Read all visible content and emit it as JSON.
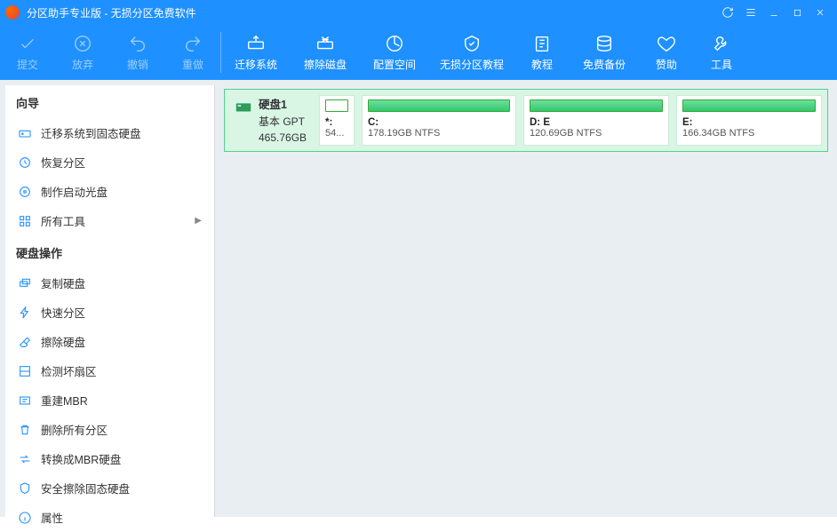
{
  "title": "分区助手专业版 - 无损分区免费软件",
  "toolbar": {
    "commit": "提交",
    "discard": "放弃",
    "undo": "撤销",
    "redo": "重做",
    "migrate": "迁移系统",
    "wipe_disk": "擦除磁盘",
    "alloc_space": "配置空间",
    "lossless_guide": "无损分区教程",
    "tutorial": "教程",
    "free_backup": "免费备份",
    "donate": "赞助",
    "tools": "工具"
  },
  "sidebar": {
    "section1": "向导",
    "items1": [
      {
        "label": "迁移系统到固态硬盘"
      },
      {
        "label": "恢复分区"
      },
      {
        "label": "制作启动光盘"
      },
      {
        "label": "所有工具",
        "chev": true
      }
    ],
    "section2": "硬盘操作",
    "items2": [
      {
        "label": "复制硬盘"
      },
      {
        "label": "快速分区"
      },
      {
        "label": "擦除硬盘"
      },
      {
        "label": "检测坏扇区"
      },
      {
        "label": "重建MBR"
      },
      {
        "label": "删除所有分区"
      },
      {
        "label": "转换成MBR硬盘"
      },
      {
        "label": "安全擦除固态硬盘"
      },
      {
        "label": "属性"
      }
    ]
  },
  "disk": {
    "name": "硬盘1",
    "type": "基本 GPT",
    "size": "465.76GB",
    "partitions": [
      {
        "label": "*:",
        "sub": "54..."
      },
      {
        "label": "C:",
        "sub": "178.19GB NTFS"
      },
      {
        "label": "D: E",
        "sub": "120.69GB NTFS"
      },
      {
        "label": "E:",
        "sub": "166.34GB NTFS"
      }
    ]
  }
}
